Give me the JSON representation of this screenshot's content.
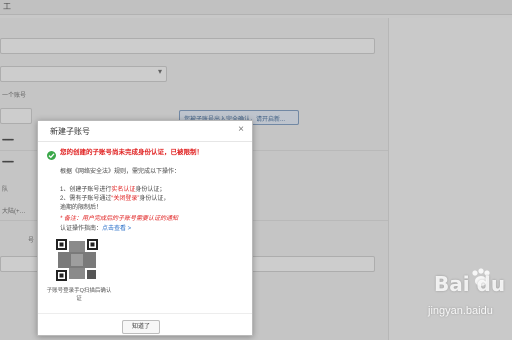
{
  "topbar": {
    "title": "工"
  },
  "background": {
    "label_account": "一个账号",
    "masked_value_1": "••••••••••",
    "masked_value_2": "••••••••••",
    "label_group": "队",
    "select_value": "大陆(+…",
    "small_label": "号",
    "banner_button": "您被子账号出入完全确认，请开启新..."
  },
  "dialog": {
    "title": "新建子账号",
    "headline": "您的创建的子账号尚未完成身份认证，已被限制！",
    "intro": "根据《网络安全法》规则，需完成以下操作：",
    "step1_prefix": "1、创建子账号进行",
    "step1_highlight": "实名认证",
    "step1_suffix": "身份认证；",
    "step2_prefix": "2、需有子账号通过",
    "step2_highlight": "“关闭登录”",
    "step2_suffix": "身份认证，",
    "step2_line2": "逾期的限制后！",
    "note": "* 备注：用户完成后的子账号需要认证的通知",
    "guide_label": "认证操作指南：",
    "guide_link": "点击查看 >",
    "qr_caption": "子账号登录手Q扫描后确认证",
    "ok_button": "知道了",
    "close_symbol": "×"
  },
  "watermark": {
    "logo": "Bai du",
    "url": "jingyan.baidu"
  },
  "colors": {
    "accent_red": "#e02020",
    "link_blue": "#2a6fc9",
    "success_green": "#3aa84a"
  }
}
